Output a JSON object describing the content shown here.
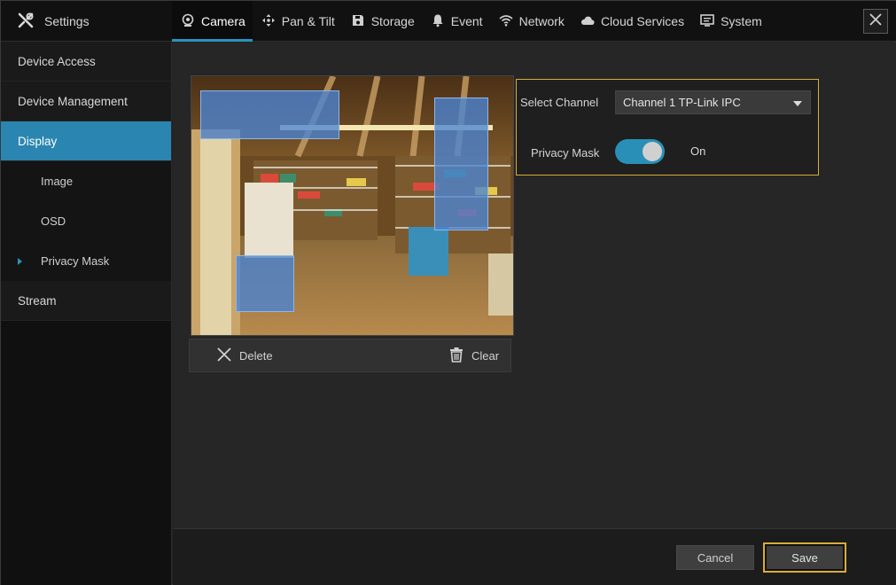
{
  "app": {
    "title": "Settings",
    "icon": "tools-icon"
  },
  "tabs": [
    {
      "label": "Camera",
      "icon": "camera-icon",
      "active": true
    },
    {
      "label": "Pan & Tilt",
      "icon": "pan-tilt-icon",
      "active": false
    },
    {
      "label": "Storage",
      "icon": "storage-icon",
      "active": false
    },
    {
      "label": "Event",
      "icon": "bell-icon",
      "active": false
    },
    {
      "label": "Network",
      "icon": "wifi-icon",
      "active": false
    },
    {
      "label": "Cloud Services",
      "icon": "cloud-icon",
      "active": false
    },
    {
      "label": "System",
      "icon": "monitor-icon",
      "active": false
    }
  ],
  "sidebar": {
    "items": [
      {
        "label": "Device Access"
      },
      {
        "label": "Device Management"
      },
      {
        "label": "Display",
        "active": true
      },
      {
        "label": "Image"
      },
      {
        "label": "OSD"
      },
      {
        "label": "Privacy Mask",
        "current": true
      },
      {
        "label": "Stream"
      }
    ]
  },
  "preview": {
    "masks": 3,
    "toolbar": {
      "delete_label": "Delete",
      "clear_label": "Clear"
    }
  },
  "settings": {
    "channel_label": "Select Channel",
    "channel_value": "Channel 1 TP-Link IPC",
    "privacy_label": "Privacy Mask",
    "privacy_state": "On",
    "privacy_enabled": true
  },
  "footer": {
    "cancel_label": "Cancel",
    "save_label": "Save"
  },
  "colors": {
    "accent": "#2a86b0",
    "highlight": "#d9ad3a",
    "mask": "#4a84d4"
  }
}
